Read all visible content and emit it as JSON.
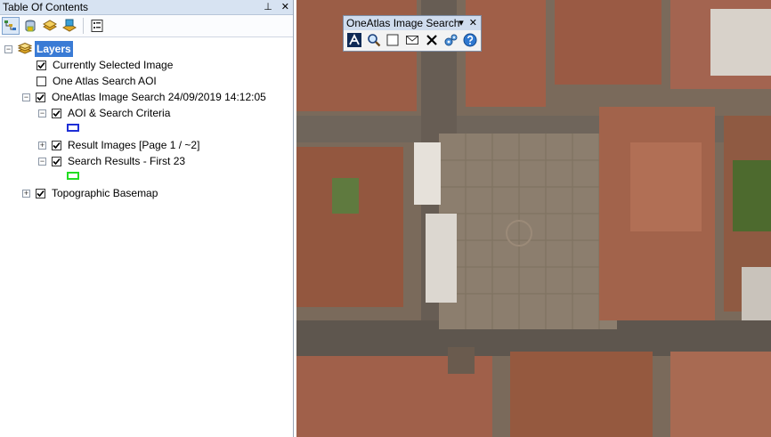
{
  "toc": {
    "title": "Table Of Contents",
    "pin_glyph": "⊥",
    "close_glyph": "✕",
    "toolbar": [
      {
        "icon": "list-by-drawing-order-icon",
        "active": true
      },
      {
        "icon": "list-by-source-icon",
        "active": false
      },
      {
        "icon": "list-by-visibility-icon",
        "active": false
      },
      {
        "icon": "list-by-selection-icon",
        "active": false
      },
      {
        "icon": "options-icon",
        "active": false
      }
    ]
  },
  "tree": {
    "root": {
      "label": "Layers",
      "expander": "−"
    },
    "items": [
      {
        "label": "Currently Selected Image",
        "checked": true
      },
      {
        "label": "One Atlas Search AOI",
        "checked": false
      },
      {
        "label": "OneAtlas Image Search 24/09/2019 14:12:05",
        "checked": true,
        "expander": "−"
      },
      {
        "label": "AOI & Search Criteria",
        "checked": true,
        "expander": "−"
      },
      {
        "label": "Result Images [Page 1 / ~2]",
        "checked": true,
        "expander": "+"
      },
      {
        "label": "Search Results - First 23",
        "checked": true,
        "expander": "−"
      },
      {
        "label": "Topographic Basemap",
        "checked": true,
        "expander": "+"
      }
    ],
    "swatches": {
      "aoi": "#1f2fd6",
      "results": "#22dd22"
    }
  },
  "oneatlas_toolbar": {
    "title": "OneAtlas Image Search",
    "dropdown_glyph": "▾",
    "close_glyph": "✕",
    "buttons": [
      {
        "icon": "oneatlas-logo-icon"
      },
      {
        "icon": "zoom-search-icon"
      },
      {
        "icon": "rectangle-select-icon"
      },
      {
        "icon": "envelope-icon"
      },
      {
        "icon": "clear-icon"
      },
      {
        "icon": "settings-icon"
      },
      {
        "icon": "help-icon"
      }
    ]
  },
  "colors": {
    "panel_title_bg": "#d7e3f2",
    "selection": "#3a7bd5",
    "map_roof": "#9a5a44",
    "map_plaza": "#8c7e6e"
  }
}
